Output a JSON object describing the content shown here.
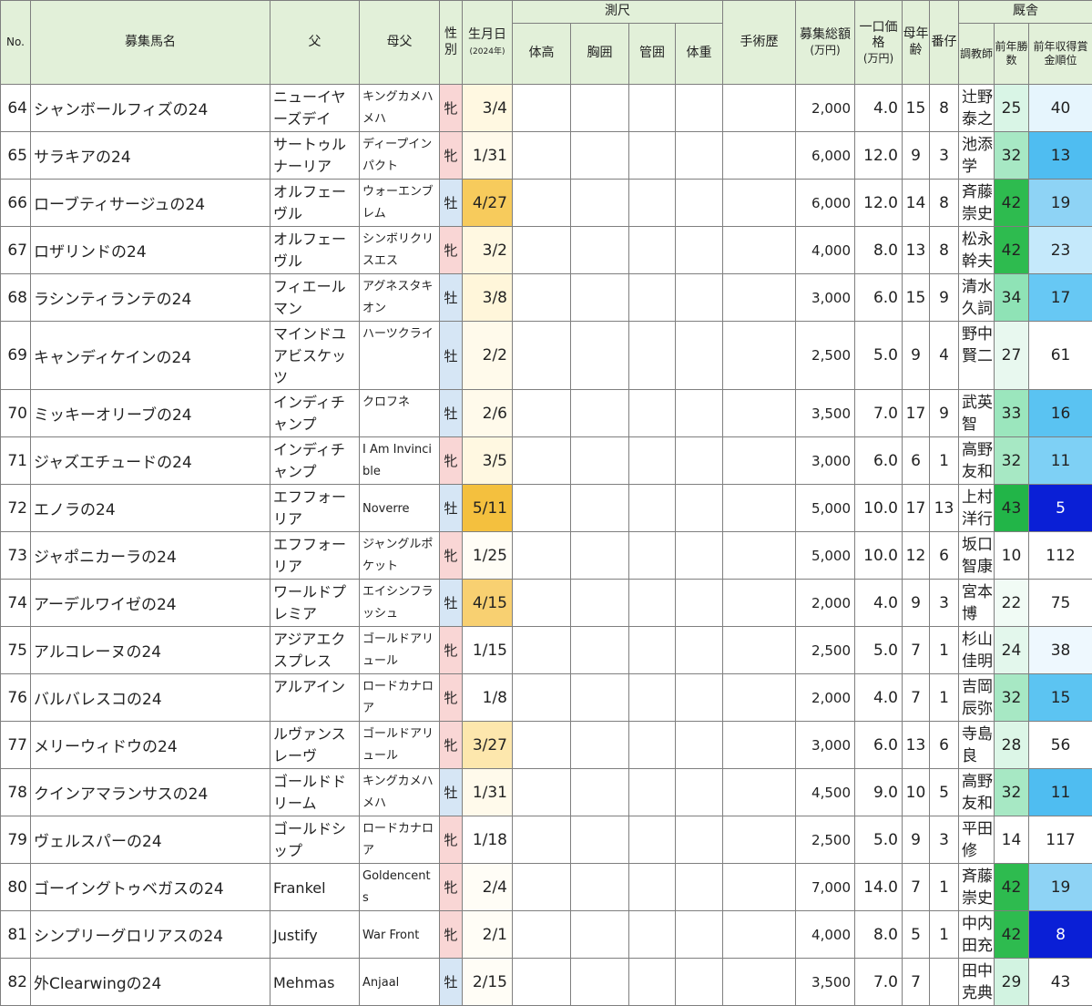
{
  "header": {
    "no": "No.",
    "name": "募集馬名",
    "sire": "父",
    "bms": "母父",
    "sex": "性別",
    "birth": "生月日",
    "birth_sub": "(2024年)",
    "measure": "測尺",
    "height": "体高",
    "chest": "胸囲",
    "cannon": "管囲",
    "weight": "体重",
    "surgery": "手術歴",
    "total": "募集総額",
    "total_unit": "(万円)",
    "price": "一口価格",
    "price_unit": "(万円)",
    "dam_age": "母年齢",
    "order": "番仔",
    "stable": "厩舎",
    "trainer": "調教師",
    "wins": "前年勝数",
    "rank": "前年収得賞金順位"
  },
  "colors": {
    "header_bg": "#e2f0d9",
    "filly": "#f9d6d5",
    "colt": "#d6e6f5",
    "birth_early": "#fff8e1",
    "birth_late": "#f6c342"
  },
  "rows": [
    {
      "no": "64",
      "name": "シャンボールフィズの24",
      "sire": "ニューイヤーズデイ",
      "bms": "キングカメハメハ",
      "sex": "牝",
      "birth": "3/4",
      "total": "2,000",
      "price": "4.0",
      "dam_age": "15",
      "order": "8",
      "trainer": "辻野泰之",
      "wins": "25",
      "rank": "40",
      "wins_color": "#d9f5e6",
      "rank_color": "#e6f5fd",
      "birth_color": "#fff8e1"
    },
    {
      "no": "65",
      "name": "サラキアの24",
      "sire": "サートゥルナーリア",
      "bms": "ディープインパクト",
      "sex": "牝",
      "birth": "1/31",
      "total": "6,000",
      "price": "12.0",
      "dam_age": "9",
      "order": "3",
      "trainer": "池添学",
      "wins": "32",
      "rank": "13",
      "wins_color": "#a7e8c4",
      "rank_color": "#4fbdf1",
      "birth_color": "#fffaeb"
    },
    {
      "no": "66",
      "name": "ローブティサージュの24",
      "sire": "オルフェーヴル",
      "bms": "ウォーエンブレム",
      "sex": "牡",
      "birth": "4/27",
      "total": "6,000",
      "price": "12.0",
      "dam_age": "14",
      "order": "8",
      "trainer": "斉藤崇史",
      "wins": "42",
      "rank": "19",
      "wins_color": "#2ebb4f",
      "rank_color": "#8ed3f5",
      "birth_color": "#f7cb5c"
    },
    {
      "no": "67",
      "name": "ロザリンドの24",
      "sire": "オルフェーヴル",
      "bms": "シンボリクリスエス",
      "sex": "牝",
      "birth": "3/2",
      "total": "4,000",
      "price": "8.0",
      "dam_age": "13",
      "order": "8",
      "trainer": "松永幹夫",
      "wins": "42",
      "rank": "23",
      "wins_color": "#2ebb4f",
      "rank_color": "#c5e9fb",
      "birth_color": "#fff8e1"
    },
    {
      "no": "68",
      "name": "ラシンティランテの24",
      "sire": "フィエールマン",
      "bms": "アグネスタキオン",
      "sex": "牡",
      "birth": "3/8",
      "total": "3,000",
      "price": "6.0",
      "dam_age": "15",
      "order": "9",
      "trainer": "清水久詞",
      "wins": "34",
      "rank": "17",
      "wins_color": "#8fe3b6",
      "rank_color": "#67c8f4",
      "birth_color": "#fff6da"
    },
    {
      "no": "69",
      "name": "キャンディケインの24",
      "sire": "マインドユアビスケッツ",
      "bms": "ハーツクライ",
      "sex": "牡",
      "birth": "2/2",
      "total": "2,500",
      "price": "5.0",
      "dam_age": "9",
      "order": "4",
      "trainer": "野中賢二",
      "wins": "27",
      "rank": "61",
      "wins_color": "#e8f8ef",
      "rank_color": "#ffffff",
      "birth_color": "#fffaeb"
    },
    {
      "no": "70",
      "name": "ミッキーオリーブの24",
      "sire": "インディチャンプ",
      "bms": "クロフネ",
      "sex": "牡",
      "birth": "2/6",
      "total": "3,500",
      "price": "7.0",
      "dam_age": "17",
      "order": "9",
      "trainer": "武英智",
      "wins": "33",
      "rank": "16",
      "wins_color": "#9be6bd",
      "rank_color": "#5ac3f2",
      "birth_color": "#fffaeb"
    },
    {
      "no": "71",
      "name": "ジャズエチュードの24",
      "sire": "インディチャンプ",
      "bms": "I Am Invincible",
      "sex": "牝",
      "birth": "3/5",
      "total": "3,000",
      "price": "6.0",
      "dam_age": "6",
      "order": "1",
      "trainer": "高野友和",
      "wins": "32",
      "rank": "11",
      "wins_color": "#a7e8c4",
      "rank_color": "#7ed0f5",
      "birth_color": "#fff8e1"
    },
    {
      "no": "72",
      "name": "エノラの24",
      "sire": "エフフォーリア",
      "bms": "Noverre",
      "sex": "牡",
      "birth": "5/11",
      "total": "5,000",
      "price": "10.0",
      "dam_age": "17",
      "order": "13",
      "trainer": "上村洋行",
      "wins": "43",
      "rank": "5",
      "wins_color": "#22b548",
      "rank_color": "#0a1fd6",
      "birth_color": "#f4c03e",
      "rank_text": "#ffffff"
    },
    {
      "no": "73",
      "name": "ジャポニカーラの24",
      "sire": "エフフォーリア",
      "bms": "ジャングルポケット",
      "sex": "牝",
      "birth": "1/25",
      "total": "5,000",
      "price": "10.0",
      "dam_age": "12",
      "order": "6",
      "trainer": "坂口智康",
      "wins": "10",
      "rank": "112",
      "wins_color": "#ffffff",
      "rank_color": "#ffffff",
      "birth_color": "#fffdf6"
    },
    {
      "no": "74",
      "name": "アーデルワイゼの24",
      "sire": "ワールドプレミア",
      "bms": "エイシンフラッシュ",
      "sex": "牡",
      "birth": "4/15",
      "total": "2,000",
      "price": "4.0",
      "dam_age": "9",
      "order": "3",
      "trainer": "宮本博",
      "wins": "22",
      "rank": "75",
      "wins_color": "#f1fbf5",
      "rank_color": "#ffffff",
      "birth_color": "#f8d071"
    },
    {
      "no": "75",
      "name": "アルコレーヌの24",
      "sire": "アジアエクスプレス",
      "bms": "ゴールドアリュール",
      "sex": "牝",
      "birth": "1/15",
      "total": "2,500",
      "price": "5.0",
      "dam_age": "7",
      "order": "1",
      "trainer": "杉山佳明",
      "wins": "24",
      "rank": "38",
      "wins_color": "#e3f7ec",
      "rank_color": "#eef8fe",
      "birth_color": "#ffffff"
    },
    {
      "no": "76",
      "name": "バルバレスコの24",
      "sire": "アルアイン",
      "bms": "ロードカナロア",
      "sex": "牝",
      "birth": "1/8",
      "total": "2,000",
      "price": "4.0",
      "dam_age": "7",
      "order": "1",
      "trainer": "吉岡辰弥",
      "wins": "32",
      "rank": "15",
      "wins_color": "#a7e8c4",
      "rank_color": "#5cc4f2",
      "birth_color": "#ffffff"
    },
    {
      "no": "77",
      "name": "メリーウィドウの24",
      "sire": "ルヴァンスレーヴ",
      "bms": "ゴールドアリュール",
      "sex": "牝",
      "birth": "3/27",
      "total": "3,000",
      "price": "6.0",
      "dam_age": "13",
      "order": "6",
      "trainer": "寺島良",
      "wins": "28",
      "rank": "56",
      "wins_color": "#dcf6e7",
      "rank_color": "#ffffff",
      "birth_color": "#fde7ad"
    },
    {
      "no": "78",
      "name": "クインアマランサスの24",
      "sire": "ゴールドドリーム",
      "bms": "キングカメハメハ",
      "sex": "牡",
      "birth": "1/31",
      "total": "4,500",
      "price": "9.0",
      "dam_age": "10",
      "order": "5",
      "trainer": "高野友和",
      "wins": "32",
      "rank": "11",
      "wins_color": "#a7e8c4",
      "rank_color": "#4fbdf1",
      "birth_color": "#fffaeb"
    },
    {
      "no": "79",
      "name": "ヴェルスパーの24",
      "sire": "ゴールドシップ",
      "bms": "ロードカナロア",
      "sex": "牝",
      "birth": "1/18",
      "total": "2,500",
      "price": "5.0",
      "dam_age": "9",
      "order": "3",
      "trainer": "平田修",
      "wins": "14",
      "rank": "117",
      "wins_color": "#ffffff",
      "rank_color": "#ffffff",
      "birth_color": "#ffffff"
    },
    {
      "no": "80",
      "name": "ゴーイングトゥベガスの24",
      "sire": "Frankel",
      "bms": "Goldencents",
      "sex": "牝",
      "birth": "2/4",
      "total": "7,000",
      "price": "14.0",
      "dam_age": "7",
      "order": "1",
      "trainer": "斉藤崇史",
      "wins": "42",
      "rank": "19",
      "wins_color": "#2ebb4f",
      "rank_color": "#8ed3f5",
      "birth_color": "#fffdf6"
    },
    {
      "no": "81",
      "name": "シンプリーグロリアスの24",
      "sire": "Justify",
      "bms": "War Front",
      "sex": "牝",
      "birth": "2/1",
      "total": "4,000",
      "price": "8.0",
      "dam_age": "5",
      "order": "1",
      "trainer": "中内田充",
      "wins": "42",
      "rank": "8",
      "wins_color": "#2ebb4f",
      "rank_color": "#0a1fd6",
      "birth_color": "#fffdf6",
      "rank_text": "#ffffff"
    },
    {
      "no": "82",
      "name": "外Clearwingの24",
      "sire": "Mehmas",
      "bms": "Anjaal",
      "sex": "牡",
      "birth": "2/15",
      "total": "3,500",
      "price": "7.0",
      "dam_age": "7",
      "order": "",
      "trainer": "田中克典",
      "wins": "29",
      "rank": "43",
      "wins_color": "#d2f3e1",
      "rank_color": "#ffffff",
      "birth_color": "#fffdf6"
    }
  ]
}
